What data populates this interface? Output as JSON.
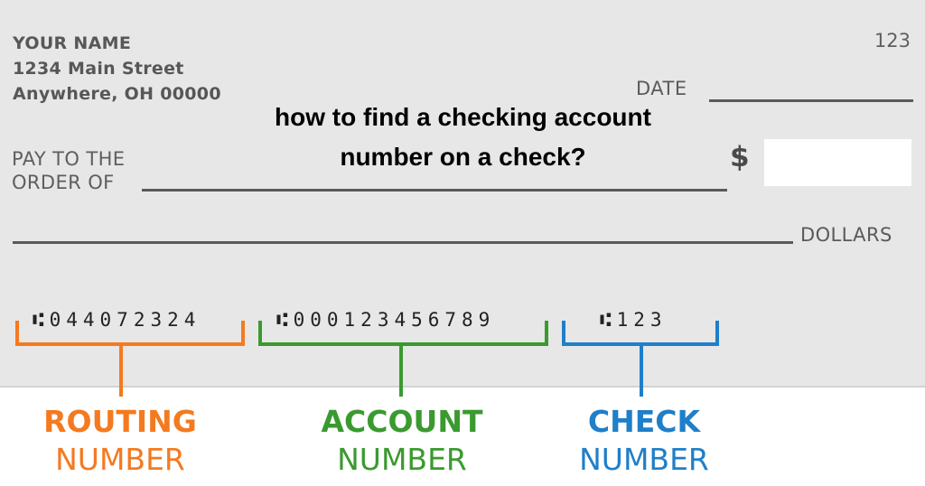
{
  "check": {
    "payer_name": "YOUR NAME",
    "payer_address_line1": "1234 Main Street",
    "payer_address_line2": "Anywhere, OH 00000",
    "check_number_top": "123",
    "date_label": "DATE",
    "pay_to_label_line1": "PAY TO THE",
    "pay_to_label_line2": "ORDER OF",
    "dollar_sign": "$",
    "dollars_label": "DOLLARS"
  },
  "overlay_title": {
    "line1": "how to find a checking account",
    "line2": "number on a check?"
  },
  "micr": {
    "routing": "⑆044072324",
    "account": "⑆000123456789",
    "check": "⑆123"
  },
  "labels": {
    "routing": {
      "line1": "ROUTING",
      "line2": "NUMBER",
      "color": "#f47a20"
    },
    "account": {
      "line1": "ACCOUNT",
      "line2": "NUMBER",
      "color": "#3a9a2f"
    },
    "check": {
      "line1": "CHECK",
      "line2": "NUMBER",
      "color": "#1f7fc8"
    }
  }
}
